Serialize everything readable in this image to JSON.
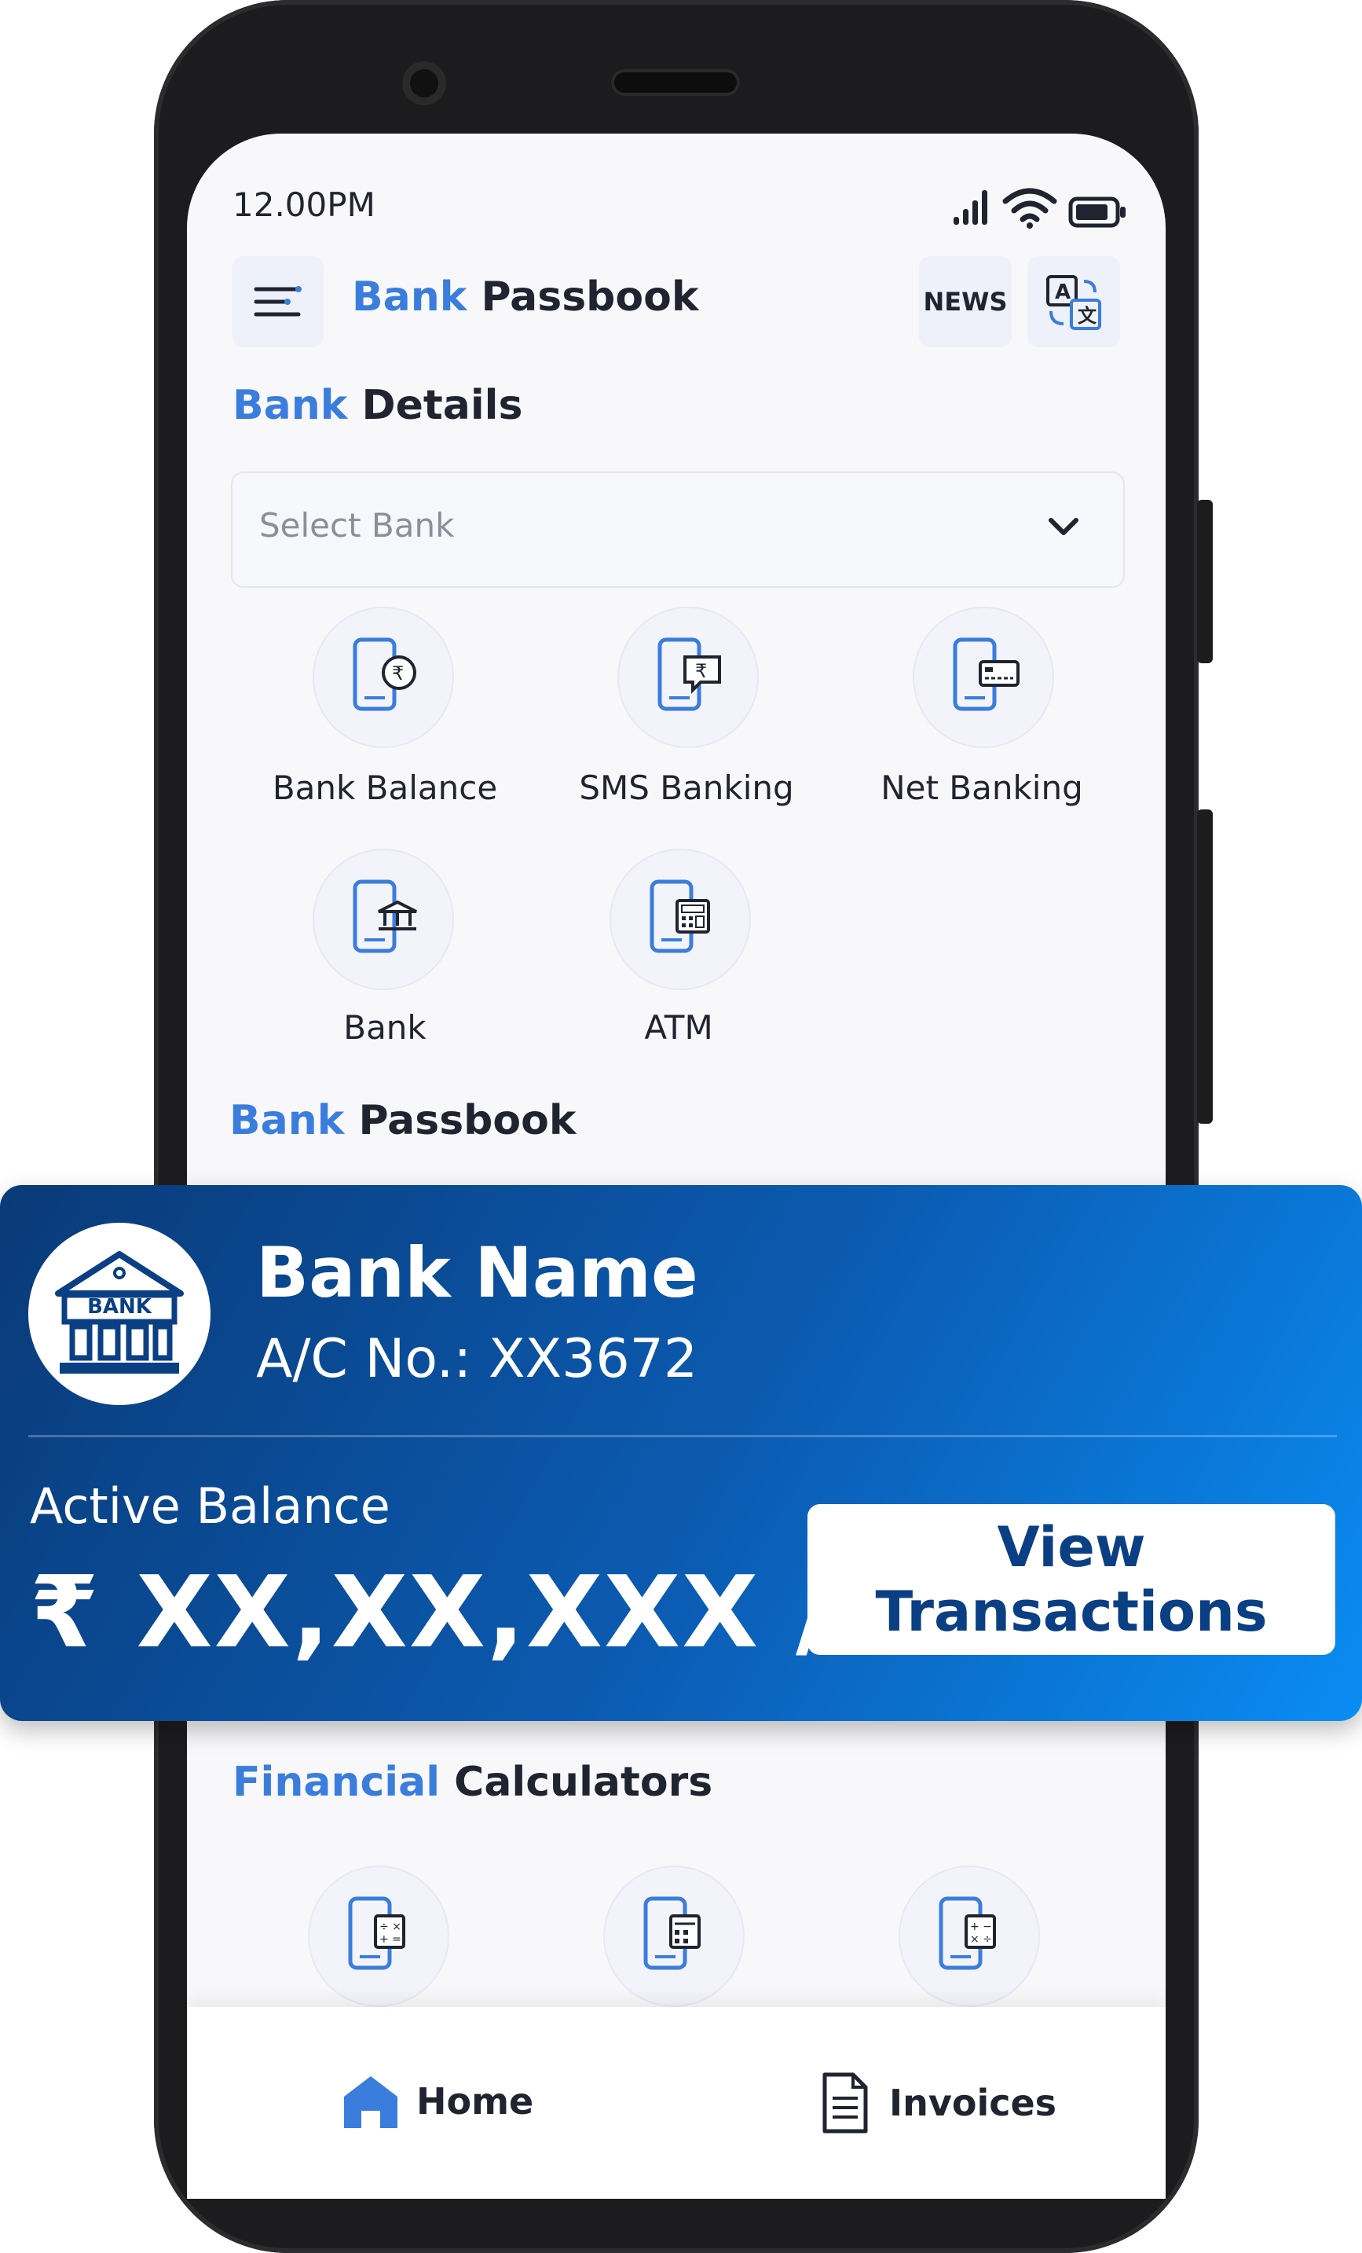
{
  "status_bar": {
    "time": "12.00PM",
    "icons": [
      "signal-icon",
      "wifi-icon",
      "battery-icon"
    ]
  },
  "header": {
    "title_part1": "Bank",
    "title_part2": "Passbook",
    "menu_icon": "menu-icon",
    "news_label": "NEWS",
    "translate_icon": "translate-icon"
  },
  "bank_details": {
    "title_part1": "Bank",
    "title_part2": "Details",
    "select_placeholder": "Select Bank",
    "features": [
      {
        "label": "Bank Balance",
        "icon": "phone-rupee-icon"
      },
      {
        "label": "SMS Banking",
        "icon": "phone-message-icon"
      },
      {
        "label": "Net Banking",
        "icon": "phone-card-icon"
      },
      {
        "label": "Bank",
        "icon": "phone-bank-icon"
      },
      {
        "label": "ATM",
        "icon": "phone-atm-icon"
      }
    ]
  },
  "passbook": {
    "title_part1": "Bank",
    "title_part2": "Passbook",
    "logo_text": "BANK",
    "bank_name": "Bank Name",
    "account_number": "A/C No.: XX3672",
    "balance_label": "Active Balance",
    "balance_value": "₹ XX,XX,XXX /-",
    "view_button": "View Transactions",
    "gradient_colors": [
      "#0a3a78",
      "#0b5cb3",
      "#0a8cf3"
    ]
  },
  "calculators": {
    "title_part1": "Financial",
    "title_part2": "Calculators",
    "icons": [
      "phone-calculator-icon",
      "phone-calculator-icon",
      "phone-calculator-icon"
    ]
  },
  "bottom_nav": {
    "home_label": "Home",
    "invoices_label": "Invoices"
  },
  "colors": {
    "accent": "#3b7ddd",
    "text_dark": "#1f2430",
    "phone_frame": "#1c1c1e"
  }
}
